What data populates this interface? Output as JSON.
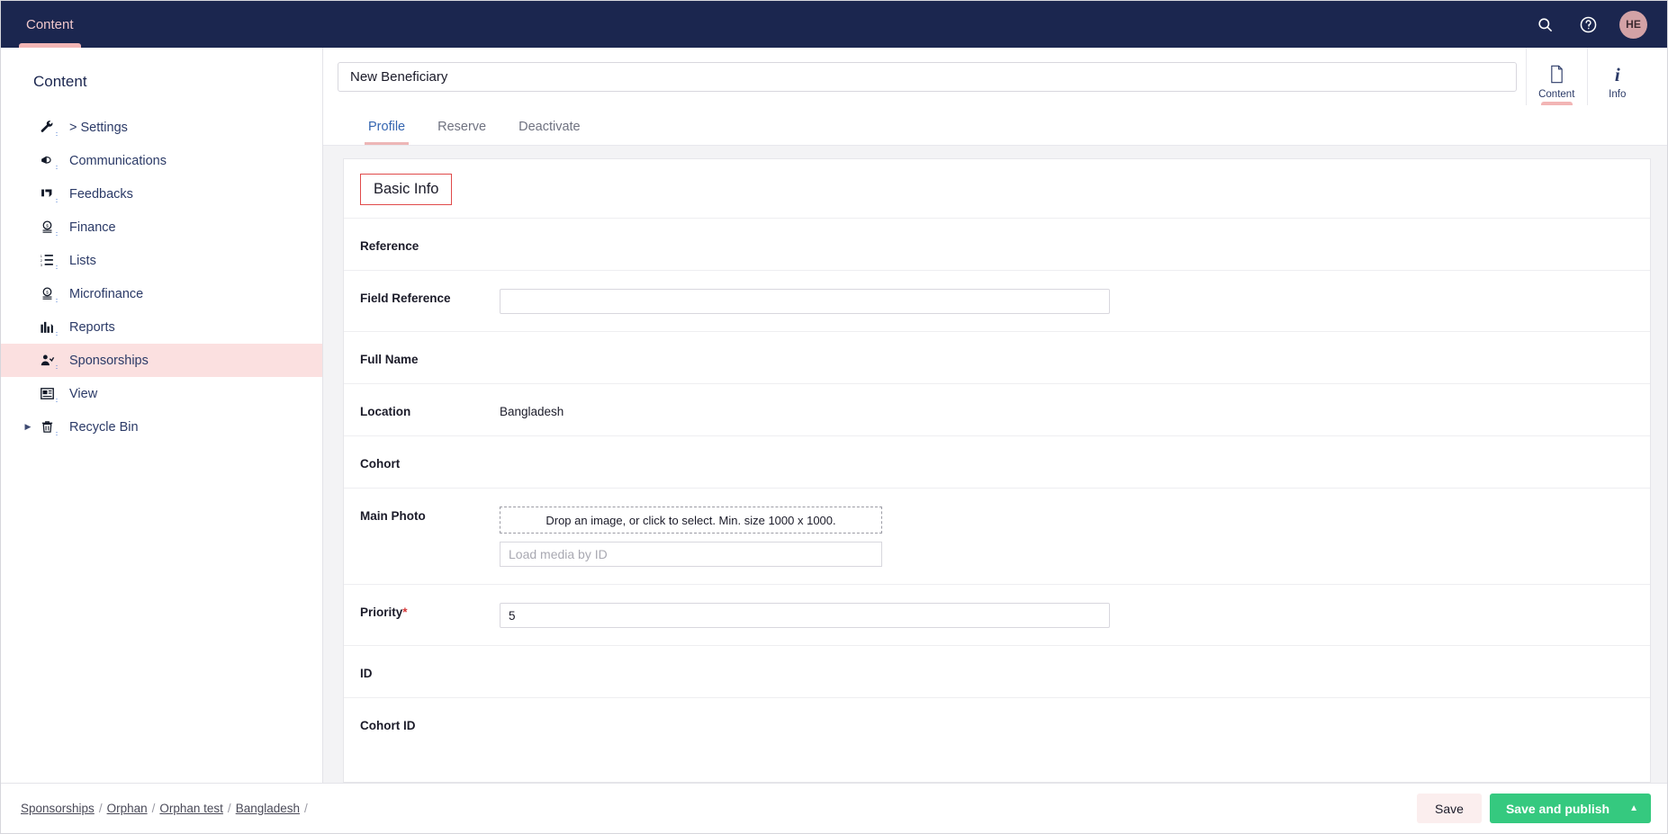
{
  "topbar": {
    "tabs": [
      {
        "label": "Content",
        "active": true
      }
    ],
    "search_icon": "search-icon",
    "help_icon": "help-icon",
    "avatar_initials": "HE"
  },
  "sidebar": {
    "title": "Content",
    "items": [
      {
        "label": "> Settings",
        "icon": "wrench-icon",
        "active": false,
        "caret": false
      },
      {
        "label": "Communications",
        "icon": "megaphone-icon",
        "active": false,
        "caret": false
      },
      {
        "label": "Feedbacks",
        "icon": "feedback-icon",
        "active": false,
        "caret": false
      },
      {
        "label": "Finance",
        "icon": "coin-icon",
        "active": false,
        "caret": false
      },
      {
        "label": "Lists",
        "icon": "list-ordered-icon",
        "active": false,
        "caret": false
      },
      {
        "label": "Microfinance",
        "icon": "coin-icon",
        "active": false,
        "caret": false
      },
      {
        "label": "Reports",
        "icon": "bar-chart-icon",
        "active": false,
        "caret": false
      },
      {
        "label": "Sponsorships",
        "icon": "people-icon",
        "active": true,
        "caret": false
      },
      {
        "label": "View",
        "icon": "article-icon",
        "active": false,
        "caret": false
      },
      {
        "label": "Recycle Bin",
        "icon": "trash-icon",
        "active": false,
        "caret": true
      }
    ]
  },
  "editor": {
    "title_value": "New Beneficiary",
    "apps": [
      {
        "label": "Content",
        "icon": "document-icon",
        "active": true
      },
      {
        "label": "Info",
        "icon": "info-icon",
        "active": false
      }
    ],
    "tabs": [
      {
        "label": "Profile",
        "active": true
      },
      {
        "label": "Reserve",
        "active": false
      },
      {
        "label": "Deactivate",
        "active": false
      }
    ],
    "panel": {
      "heading": "Basic Info",
      "heading_highlight_color": "#e04a4a",
      "fields": [
        {
          "label": "Reference",
          "type": "empty",
          "value": ""
        },
        {
          "label": "Field Reference",
          "type": "text",
          "value": ""
        },
        {
          "label": "Full Name",
          "type": "empty",
          "value": ""
        },
        {
          "label": "Location",
          "type": "static",
          "value": "Bangladesh"
        },
        {
          "label": "Cohort",
          "type": "empty",
          "value": ""
        },
        {
          "label": "Main Photo",
          "type": "media",
          "dropzone_text": "Drop an image, or click to select. Min. size 1000 x 1000.",
          "media_id_placeholder": "Load media by ID",
          "media_id_value": ""
        },
        {
          "label": "Priority",
          "type": "text",
          "required": true,
          "value": "5"
        },
        {
          "label": "ID",
          "type": "empty",
          "value": ""
        },
        {
          "label": "Cohort ID",
          "type": "empty",
          "value": ""
        }
      ]
    }
  },
  "footer": {
    "breadcrumb": [
      {
        "label": "Sponsorships"
      },
      {
        "label": "Orphan"
      },
      {
        "label": "Orphan test"
      },
      {
        "label": "Bangladesh"
      }
    ],
    "breadcrumb_separator": "/",
    "save_label": "Save",
    "publish_label": "Save and publish",
    "publish_color": "#35c97f"
  }
}
